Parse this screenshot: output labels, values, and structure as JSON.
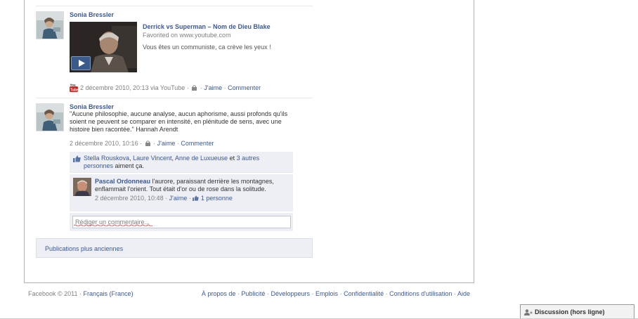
{
  "story1": {
    "actor": "Sonia Bressler",
    "attachment": {
      "title": "Derrick vs Superman – Nom de Dieu Blake",
      "caption": "Favorited on www.youtube.com",
      "description": "Vous êtes un communiste, ca crève les yeux !"
    },
    "source_icon": "youtube-icon",
    "timestamp": "2 décembre 2010, 20:13 via YouTube",
    "sep": "·",
    "like_label": "J'aime",
    "comment_label": "Commenter"
  },
  "story2": {
    "actor": "Sonia Bressler",
    "quote": "\"Aucune philosophie, aucune analyse, aucun aphorisme, aussi profonds qu'ils soient ne peuvent se comparer en intensité, en plénitude de sens, avec une histoire bien racontée.\" Hannah Arendt",
    "timestamp": "2 décembre 2010, 10:16",
    "sep": "·",
    "like_label": "J'aime",
    "comment_label": "Commenter",
    "likes": {
      "names": [
        "Stella Rouskova",
        "Laure Vincent",
        "Anne de Luxueuse"
      ],
      "comma": ",",
      "and_text": "et",
      "others_link": "3 autres personnes",
      "suffix": "aiment ça."
    },
    "comment": {
      "author": "Pascal Ordonneau",
      "text": "l'aurore, paraissant derrière les montagnes, enflammait l'orient. Tout était d'or ou de rose dans la solitude.",
      "timestamp": "2 décembre 2010, 10:48",
      "sep": "·",
      "like_label": "J'aime",
      "like_count": "1 personne"
    },
    "write_placeholder": "Rédiger un commentaire..."
  },
  "older_posts_label": "Publications plus anciennes",
  "footer": {
    "copyright": "Facebook © 2011",
    "sep": "·",
    "language": "Français (France)",
    "links": [
      "À propos de",
      "Publicité",
      "Développeurs",
      "Emplois",
      "Confidentialité",
      "Conditions d'utilisation",
      "Aide"
    ]
  },
  "chat": {
    "label": "Discussion (hors ligne)",
    "icon": "chat-user-icon"
  },
  "colors": {
    "link": "#3b5998",
    "ufi_bg": "#edeff4",
    "muted": "#808080"
  }
}
